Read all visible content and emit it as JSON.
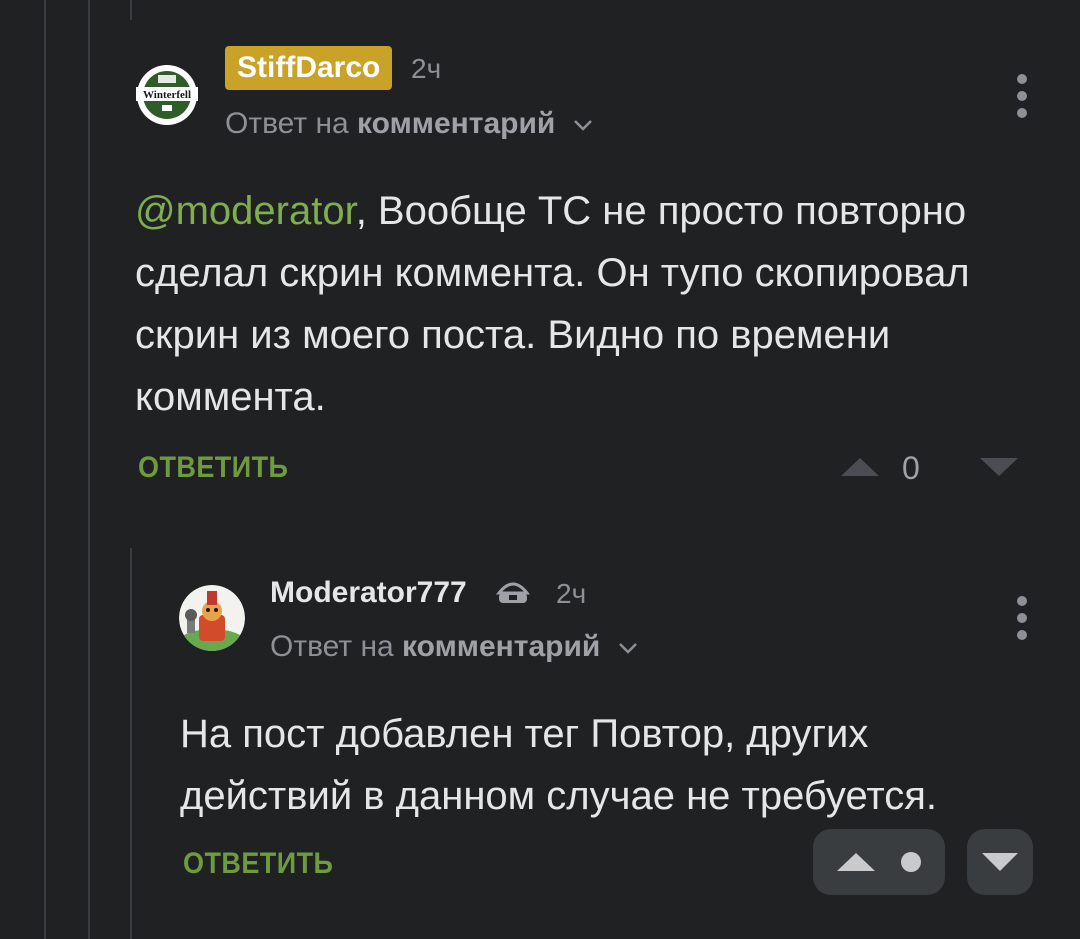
{
  "comments": [
    {
      "username": "StiffDarco",
      "time": "2ч",
      "avatar_icon": "winterfell-beer-logo",
      "avatar_text": "Winterfell",
      "reply_prefix": "Ответ на",
      "reply_target": "комментарий",
      "mention": "@moderator",
      "text": ", Вообще ТС не просто повторно сделал скрин коммента. Он тупо скопировал скрин из моего поста. Видно по времени коммента.",
      "reply_button": "ОТВЕТИТЬ",
      "rating": "0",
      "badge_color": "#c9a227"
    },
    {
      "username": "Moderator777",
      "time": "2ч",
      "avatar_icon": "cartoon-character-avatar",
      "role_icon": "moderator-hat-icon",
      "reply_prefix": "Ответ на",
      "reply_target": "комментарий",
      "text": "На пост добавлен тег Повтор, других действий в данном случае не требуется.",
      "reply_button": "ОТВЕТИТЬ"
    }
  ],
  "colors": {
    "background": "#1f2123",
    "accent_green": "#6f9b3f",
    "mention_green": "#7fae4c",
    "muted": "#8d9196"
  }
}
